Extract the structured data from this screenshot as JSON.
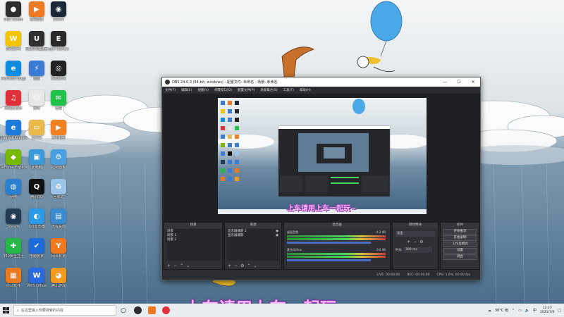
{
  "desktop": {
    "icons": [
      {
        "label": "OBS Studio",
        "color": "#2d2d2d",
        "glyph": "●"
      },
      {
        "label": "高清影音",
        "color": "#f07a22",
        "glyph": "▶"
      },
      {
        "label": "Steam",
        "color": "#1b2838",
        "glyph": "◉"
      },
      {
        "label": "WeGame",
        "color": "#f5c400",
        "glyph": "W"
      },
      {
        "label": "网易UU加速器",
        "color": "#303030",
        "glyph": "U"
      },
      {
        "label": "Epic Games",
        "color": "#2a2a2a",
        "glyph": "E"
      },
      {
        "label": "Microsoft Edge",
        "color": "#0f8be0",
        "glyph": "e"
      },
      {
        "label": "迅雷",
        "color": "#3a7bd5",
        "glyph": "⚡"
      },
      {
        "label": "WeGame",
        "color": "#222222",
        "glyph": "◎"
      },
      {
        "label": "网易云音乐",
        "color": "#e0303a",
        "glyph": "♫"
      },
      {
        "label": "雷神",
        "color": "#e8e8e8",
        "glyph": "☺"
      },
      {
        "label": "微信",
        "color": "#20c24a",
        "glyph": "✉"
      },
      {
        "label": "Internet Explorer",
        "color": "#1e7ad8",
        "glyph": "e"
      },
      {
        "label": "文件夹",
        "color": "#e8b84a",
        "glyph": "▭"
      },
      {
        "label": "腾讯视频",
        "color": "#f08020",
        "glyph": "▶"
      },
      {
        "label": "GeForce Experience",
        "color": "#76b900",
        "glyph": "◆"
      },
      {
        "label": "此电脑",
        "color": "#3a9ad8",
        "glyph": "▣"
      },
      {
        "label": "控制面板",
        "color": "#4aa0e0",
        "glyph": "⚙"
      },
      {
        "label": "网络",
        "color": "#2a7fd0",
        "glyph": "◍"
      },
      {
        "label": "腾讯QQ",
        "color": "#111111",
        "glyph": "Q"
      },
      {
        "label": "回收站",
        "color": "#9cc4e8",
        "glyph": "♻"
      },
      {
        "label": "Steam",
        "color": "#233a55",
        "glyph": "◉"
      },
      {
        "label": "QQ浏览器",
        "color": "#2a9ae8",
        "glyph": "◐"
      },
      {
        "label": "远程桌面",
        "color": "#3a8ad0",
        "glyph": "▤"
      },
      {
        "label": "360安全卫士",
        "color": "#27b84a",
        "glyph": "✚"
      },
      {
        "label": "电脑管家",
        "color": "#1e6ad8",
        "glyph": "✔"
      },
      {
        "label": "网易有道",
        "color": "#f07a20",
        "glyph": "Y"
      },
      {
        "label": "办公软件",
        "color": "#e87a20",
        "glyph": "▦"
      },
      {
        "label": "WPS Office",
        "color": "#2a6ae0",
        "glyph": "W"
      },
      {
        "label": "腾讯游戏",
        "color": "#f09a20",
        "glyph": "◕"
      }
    ]
  },
  "obs": {
    "title": "OBS 24.0.3 (64-bit, windows) - 配置文件: 未命名 - 场景: 未命名",
    "menu": [
      "文件(F)",
      "编辑(E)",
      "视图(V)",
      "停靠窗口(D)",
      "配置文件(P)",
      "场景集合(S)",
      "工具(T)",
      "帮助(H)"
    ],
    "docks": {
      "scenes": {
        "title": "场景",
        "items": [
          "场景",
          "场景 1",
          "场景 2"
        ]
      },
      "sources": {
        "title": "来源",
        "items": [
          "显示器捕获 2",
          "显示器捕获"
        ]
      },
      "mixer": {
        "title": "混音器",
        "channels": [
          {
            "name": "桌面音频",
            "db": "-4.2 dB"
          },
          {
            "name": "麦克风/Aux",
            "db": "0.0 dB"
          }
        ]
      },
      "transitions": {
        "title": "转场特效",
        "type": "淡出",
        "duration_label": "时长",
        "duration": "300 ms"
      },
      "controls": {
        "title": "控件",
        "buttons": [
          "开始推流",
          "开始录制",
          "工作室模式",
          "设置",
          "退出"
        ]
      }
    },
    "status": {
      "live": "LIVE: 00:00:00",
      "rec": "REC: 00:00:00",
      "cpu": "CPU: 1.6%, 60.00 fps"
    },
    "preview_subtitle": "上车请用上车一起玩~"
  },
  "taskbar": {
    "search_placeholder": "在这里输入你要搜索的内容",
    "tray_temp": "30°C 雨",
    "tray_lang": "中",
    "time": "12:23",
    "date": "2021/7/9"
  },
  "subtitle": "上车请用上车一起玩~"
}
